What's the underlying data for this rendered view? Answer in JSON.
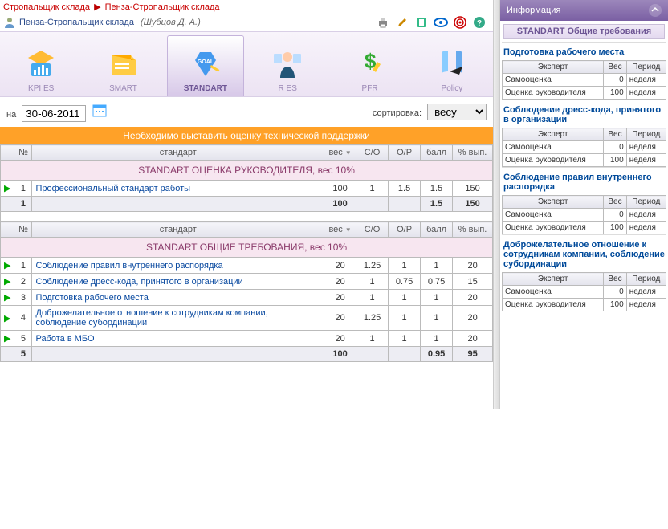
{
  "breadcrumb": {
    "a": "Стропальщик склада",
    "b": "Пенза-Стропальщик склада"
  },
  "user": {
    "role_link": "Пенза-Стропальщик склада",
    "name": "(Шубцов Д. А.)"
  },
  "tabs": {
    "kpi": "KPI ES",
    "smart": "SMART",
    "standart": "STANDART",
    "res": "R ES",
    "pfr": "PFR",
    "policy": "Policy"
  },
  "filter": {
    "on_label": "на",
    "date": "30-06-2011",
    "sort_label": "сортировка:",
    "sort_value": "весу"
  },
  "banner": "Необходимо выставить оценку технической поддержки",
  "grid": {
    "h_num": "№",
    "h_standard": "стандарт",
    "h_weight": "вес",
    "h_so": "С/О",
    "h_or": "О/Р",
    "h_score": "балл",
    "h_pct": "% вып."
  },
  "section1": {
    "title": "STANDART ОЦЕНКА РУКОВОДИТЕЛЯ, вес 10%",
    "rows": [
      {
        "n": "1",
        "name": "Профессиональный стандарт работы",
        "w": "100",
        "so": "1",
        "or": "1.5",
        "score": "1.5",
        "pct": "150"
      }
    ],
    "total": {
      "n": "1",
      "w": "100",
      "score": "1.5",
      "pct": "150"
    }
  },
  "section2": {
    "title": "STANDART ОБЩИЕ ТРЕБОВАНИЯ, вес 10%",
    "rows": [
      {
        "n": "1",
        "name": "Соблюдение правил внутреннего распорядка",
        "w": "20",
        "so": "1.25",
        "or": "1",
        "score": "1",
        "pct": "20"
      },
      {
        "n": "2",
        "name": "Соблюдение дресс-кода, принятого в организации",
        "w": "20",
        "so": "1",
        "or": "0.75",
        "score": "0.75",
        "pct": "15"
      },
      {
        "n": "3",
        "name": "Подготовка рабочего места",
        "w": "20",
        "so": "1",
        "or": "1",
        "score": "1",
        "pct": "20"
      },
      {
        "n": "4",
        "name": "Доброжелательное отношение к сотрудникам компании, соблюдение субординации",
        "w": "20",
        "so": "1.25",
        "or": "1",
        "score": "1",
        "pct": "20"
      },
      {
        "n": "5",
        "name": "Работа в МБО",
        "w": "20",
        "so": "1",
        "or": "1",
        "score": "1",
        "pct": "20"
      }
    ],
    "total": {
      "n": "5",
      "w": "100",
      "score": "0.95",
      "pct": "95"
    }
  },
  "side": {
    "title": "Информация",
    "chip": "STANDART Общие требования",
    "cols": {
      "expert": "Эксперт",
      "weight": "Вес",
      "period": "Период"
    },
    "row_self": "Самооценка",
    "row_mgr": "Оценка руководителя",
    "period": "неделя",
    "v0": "0",
    "v100": "100",
    "blocks": [
      {
        "title": "Подготовка рабочего места"
      },
      {
        "title": "Соблюдение дресс-кода, принятого в организации"
      },
      {
        "title": "Соблюдение правил внутреннего распорядка"
      },
      {
        "title": "Доброжелательное отношение к сотрудникам компании, соблюдение субординации"
      }
    ]
  }
}
